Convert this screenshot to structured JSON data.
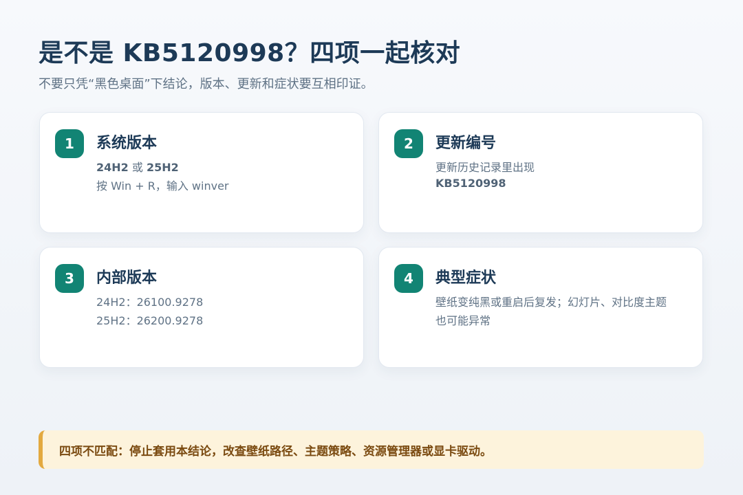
{
  "header": {
    "title": "是不是 KB5120998？四项一起核对",
    "subtitle": "不要只凭“黑色桌面”下结论，版本、更新和症状要互相印证。"
  },
  "cards": [
    {
      "number": "1",
      "title": "系统版本",
      "line1_a": "24H2",
      "line1_b": " 或 ",
      "line1_c": "25H2",
      "line2": "按 Win + R，输入 winver"
    },
    {
      "number": "2",
      "title": "更新编号",
      "line1": "更新历史记录里出现",
      "line2": "KB5120998"
    },
    {
      "number": "3",
      "title": "内部版本",
      "line1": "24H2：26100.9278",
      "line2": "25H2：26200.9278"
    },
    {
      "number": "4",
      "title": "典型症状",
      "line1": "壁纸变纯黑或重启后复发；幻灯片、对比度主题",
      "line2": "也可能异常"
    }
  ],
  "banner": {
    "text": "四项不匹配：停止套用本结论，改查壁纸路径、主题策略、资源管理器或显卡驱动。"
  },
  "colors": {
    "accent": "#128474",
    "title": "#1d3a57",
    "muted": "#5f7285",
    "warning_bg": "#fdf3dc",
    "warning_border": "#e3a93f",
    "warning_text": "#7a4a10"
  }
}
